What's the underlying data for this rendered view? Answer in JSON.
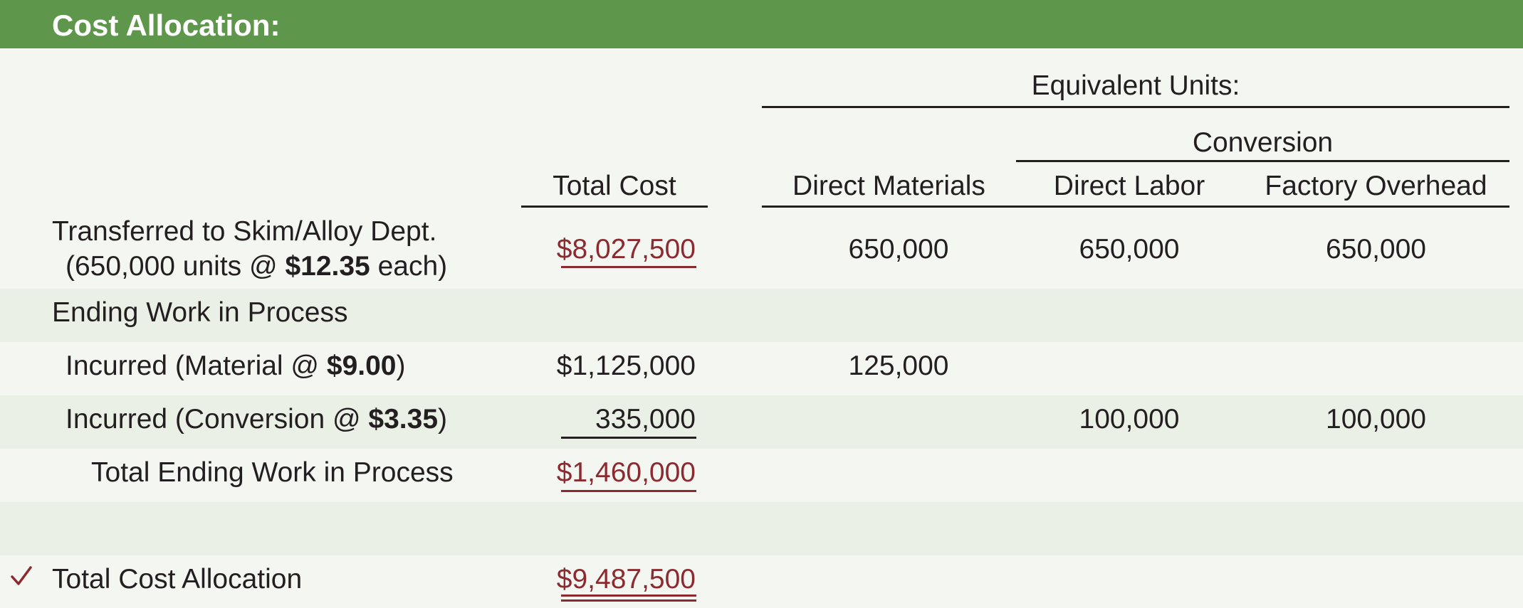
{
  "header": {
    "title": "Cost Allocation:"
  },
  "columns": {
    "equivalent_units": "Equivalent Units:",
    "conversion": "Conversion",
    "total_cost": "Total Cost",
    "direct_materials": "Direct Materials",
    "direct_labor": "Direct Labor",
    "factory_overhead": "Factory Overhead"
  },
  "rows": {
    "transferred": {
      "label_line1": "Transferred to Skim/Alloy Dept.",
      "label_line2_prefix": "(650,000 units @ ",
      "label_line2_rate": "$12.35",
      "label_line2_suffix": " each)",
      "total_cost": "$8,027,500",
      "direct_materials": "650,000",
      "direct_labor": "650,000",
      "factory_overhead": "650,000"
    },
    "ending_wip": {
      "label": "Ending Work in Process"
    },
    "incurred_material": {
      "label_prefix": "Incurred (Material @ ",
      "label_rate": "$9.00",
      "label_suffix": ")",
      "total_cost": "$1,125,000",
      "direct_materials": "125,000"
    },
    "incurred_conversion": {
      "label_prefix": "Incurred (Conversion @ ",
      "label_rate": "$3.35",
      "label_suffix": ")",
      "total_cost": "335,000",
      "direct_labor": "100,000",
      "factory_overhead": "100,000"
    },
    "total_ending_wip": {
      "label": "Total Ending Work in Process",
      "total_cost": "$1,460,000"
    },
    "total_cost_allocation": {
      "icon": "checkmark-icon",
      "label": "Total Cost Allocation",
      "total_cost": "$9,487,500"
    }
  },
  "colors": {
    "header": "#5e974b",
    "background": "#f4f6f1",
    "band": "#ebf0e6",
    "accent_red": "#8b2a2f"
  }
}
